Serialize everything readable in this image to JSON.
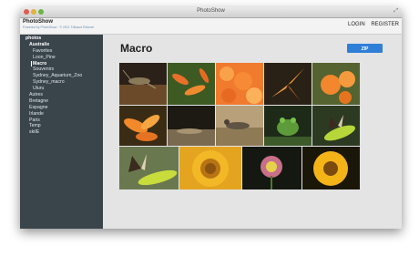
{
  "window": {
    "title": "PhotoShow"
  },
  "header": {
    "brand": "PhotoShow",
    "brand_sub": "Powered by PhotoShow · © 2011 Thibaud Rohmer",
    "nav": {
      "login": "LOGIN",
      "register": "REGISTER"
    }
  },
  "sidebar": {
    "root": "photos",
    "items": [
      {
        "label": "Australie"
      },
      {
        "label": "Favorites"
      },
      {
        "label": "Loon_Pine"
      },
      {
        "label": "Macro"
      },
      {
        "label": "Souvenirs"
      },
      {
        "label": "Sydney_Aquarium_Zoo"
      },
      {
        "label": "Sydney_macro"
      },
      {
        "label": "Uluru"
      },
      {
        "label": "Autres"
      },
      {
        "label": "Bretagne"
      },
      {
        "label": "Espagne"
      },
      {
        "label": "Irlande"
      },
      {
        "label": "Paris"
      },
      {
        "label": "Temp"
      },
      {
        "label": "skiIE"
      }
    ]
  },
  "main": {
    "title": "Macro",
    "zip_label": "ZIP"
  },
  "colors": {
    "sidebar_bg": "#3a444b",
    "accent": "#2f7fd8",
    "main_bg": "#e4e4e4"
  }
}
